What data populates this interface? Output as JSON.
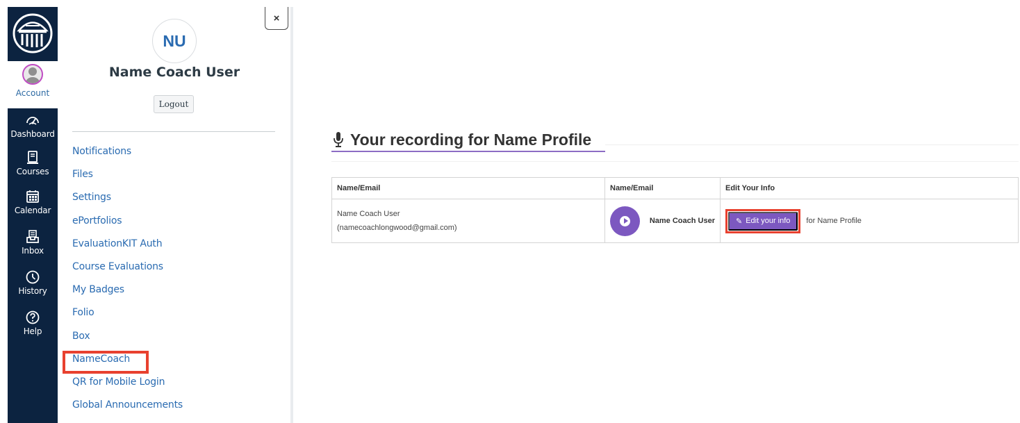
{
  "global_nav": {
    "account_label": "Account",
    "items": [
      {
        "label": "Dashboard",
        "icon": "dashboard-icon"
      },
      {
        "label": "Courses",
        "icon": "courses-icon"
      },
      {
        "label": "Calendar",
        "icon": "calendar-icon"
      },
      {
        "label": "Inbox",
        "icon": "inbox-icon"
      },
      {
        "label": "History",
        "icon": "history-icon"
      },
      {
        "label": "Help",
        "icon": "help-icon"
      }
    ],
    "colors": {
      "background": "#0c2340",
      "account_ring": "#c04bc4"
    }
  },
  "tray": {
    "close_label": "×",
    "avatar_initials": "NU",
    "user_name": "Name Coach User",
    "logout_label": "Logout",
    "links": [
      "Notifications",
      "Files",
      "Settings",
      "ePortfolios",
      "EvaluationKIT Auth",
      "Course Evaluations",
      "My Badges",
      "Folio",
      "Box",
      "NameCoach",
      "QR for Mobile Login",
      "Global Announcements"
    ],
    "link_color": "#2a6bb1"
  },
  "content": {
    "heading": "Your recording for Name Profile",
    "table": {
      "headers": [
        "Name/Email",
        "Name/Email",
        "Edit Your Info"
      ],
      "row": {
        "name": "Name Coach User",
        "email": "(namecoachlongwood@gmail.com)",
        "recorded_name": "Name Coach User",
        "edit_label": "Edit your info",
        "edit_suffix": "for Name Profile"
      }
    },
    "accent_color": "#7c58c0",
    "highlight_color": "#e8412f"
  }
}
